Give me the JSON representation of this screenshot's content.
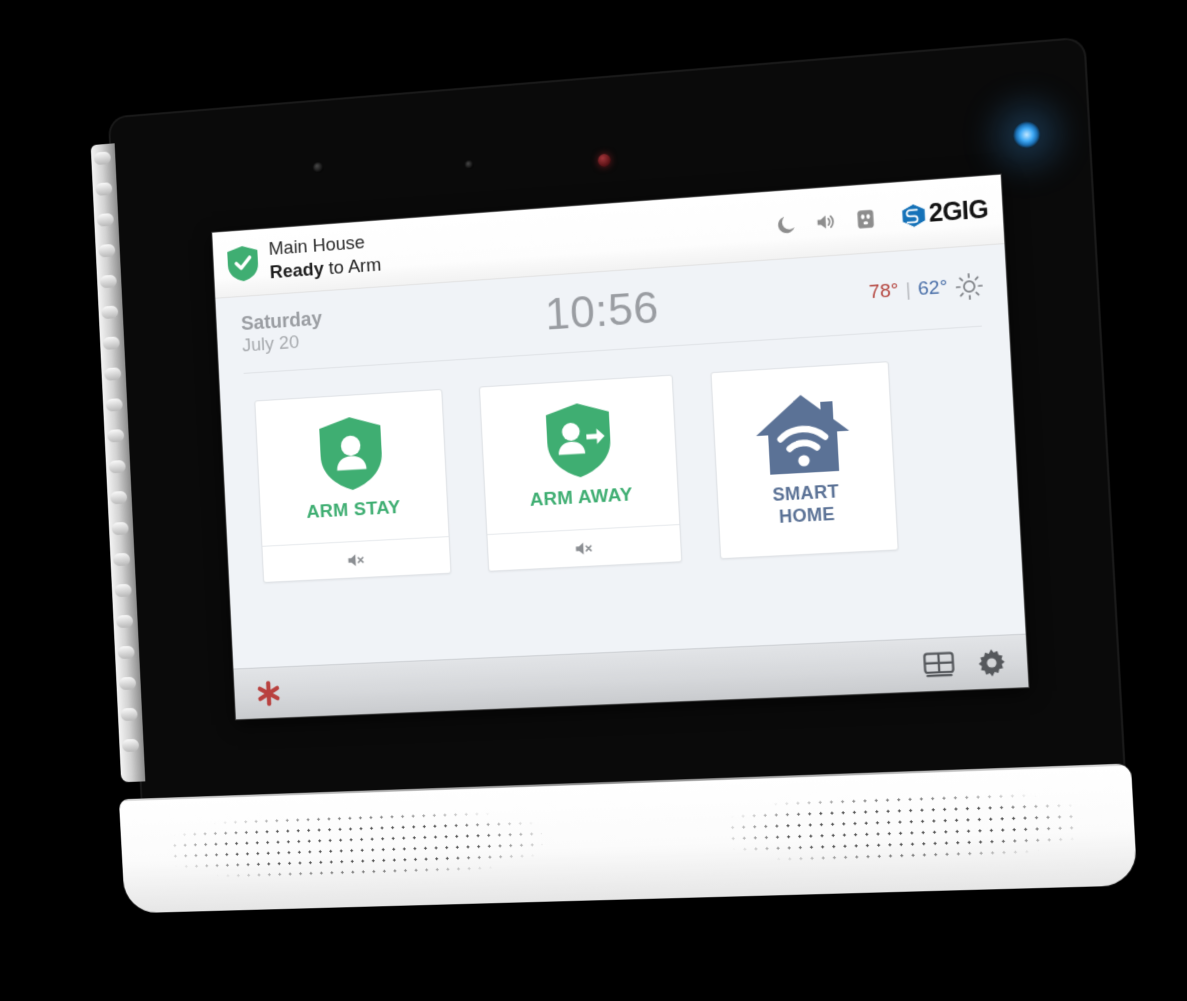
{
  "device": {
    "brand": "2GIG",
    "led_color": "#3fa9f5",
    "sensors": [
      "ambient-light-sensor",
      "microphone",
      "ir-led"
    ]
  },
  "screen": {
    "status_bar": {
      "shield_icon": "shield-check-icon",
      "panel_name": "Main House",
      "state_strong": "Ready",
      "state_rest": " to Arm",
      "icons": [
        {
          "name": "moon-icon",
          "label": "Night Mode"
        },
        {
          "name": "speaker-icon",
          "label": "Volume"
        },
        {
          "name": "outlet-icon",
          "label": "AC Power"
        }
      ],
      "logo_word": "2GIG",
      "logo_mark": "cube-logo-icon"
    },
    "info_row": {
      "weekday": "Saturday",
      "day_month": "July 20",
      "time": "10:56",
      "temp_high": "78°",
      "temp_separator": "|",
      "temp_low": "62°",
      "weather_icon": "sun-icon",
      "color_high": "#b4443d",
      "color_low": "#4a6fa8"
    },
    "cards": [
      {
        "id": "arm-stay",
        "label": "ARM STAY",
        "icon": "shield-person-icon",
        "color": "#3fae72",
        "footer_icon": "speaker-muted-icon"
      },
      {
        "id": "arm-away",
        "label": "ARM AWAY",
        "icon": "shield-person-arrow-icon",
        "color": "#3fae72",
        "footer_icon": "speaker-muted-icon"
      }
    ],
    "smart_home": {
      "id": "smart-home",
      "label_line1": "SMART",
      "label_line2": "HOME",
      "icon": "house-wifi-icon",
      "color": "#5b7296"
    },
    "bottom_bar": {
      "panic_icon": "emergency-asterisk-icon",
      "panic_color": "#b9413f",
      "keypad_icon": "keypad-icon",
      "settings_icon": "gear-icon"
    }
  }
}
